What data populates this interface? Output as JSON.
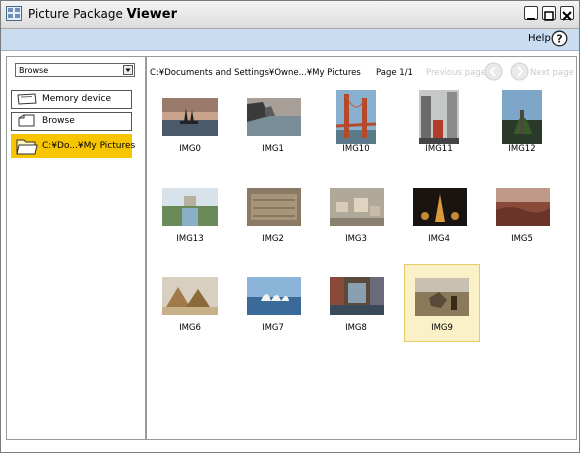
{
  "window": {
    "title_regular": "Picture Package",
    "title_bold": "Viewer"
  },
  "menubar": {
    "help_label": "Help"
  },
  "sidebar": {
    "dropdown_value": "Browse",
    "items": [
      {
        "label": "Memory device",
        "icon": "memory-device-icon"
      },
      {
        "label": "Browse",
        "icon": "browse-icon"
      },
      {
        "label": "C:¥Do...¥My Pictures",
        "icon": "folder-icon",
        "selected": true
      }
    ]
  },
  "toolbar": {
    "path": "C:¥Documents and Settings¥Owne...¥My Pictures",
    "page_info": "Page 1/1",
    "previous_label": "Previous page",
    "next_label": "Next page"
  },
  "thumbnails": [
    {
      "name": "IMG0"
    },
    {
      "name": "IMG1"
    },
    {
      "name": "IMG10"
    },
    {
      "name": "IMG11"
    },
    {
      "name": "IMG12"
    },
    {
      "name": "IMG13"
    },
    {
      "name": "IMG2"
    },
    {
      "name": "IMG3"
    },
    {
      "name": "IMG4"
    },
    {
      "name": "IMG5"
    },
    {
      "name": "IMG6"
    },
    {
      "name": "IMG7"
    },
    {
      "name": "IMG8"
    },
    {
      "name": "IMG9",
      "selected": true
    }
  ],
  "colors": {
    "accent_selected": "#f7c600",
    "menubar": "#c9dcf0",
    "selected_tile": "#fbf1c7"
  }
}
